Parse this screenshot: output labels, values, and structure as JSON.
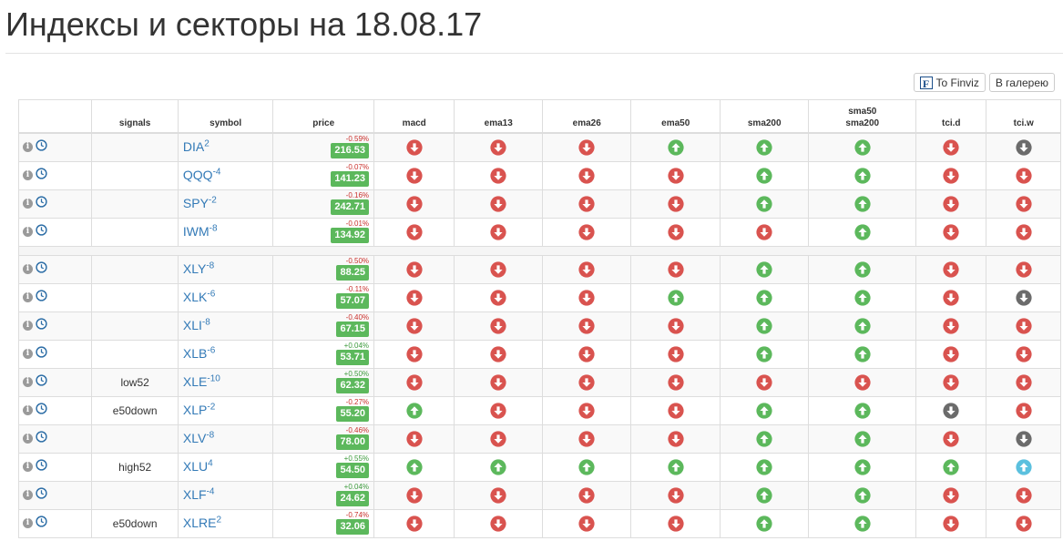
{
  "page": {
    "title": "Индексы и секторы на 18.08.17",
    "finviz_label": "To Finviz",
    "gallery_label": "В галерею",
    "finviz_logo": "F"
  },
  "table": {
    "headers": [
      "",
      "signals",
      "symbol",
      "price",
      "macd",
      "ema13",
      "ema26",
      "ema50",
      "sma200",
      "sma50\nsma200",
      "tci.d",
      "tci.w"
    ],
    "info_glyph": "i",
    "groups": [
      [
        {
          "signal": "",
          "symbol": "DIA",
          "sup": "2",
          "change": "-0.59%",
          "price": "216.53",
          "ind": [
            "down",
            "down",
            "down",
            "up",
            "up",
            "up",
            "down",
            "down-gray"
          ]
        },
        {
          "signal": "",
          "symbol": "QQQ",
          "sup": "-4",
          "change": "-0.07%",
          "price": "141.23",
          "ind": [
            "down",
            "down",
            "down",
            "down",
            "up",
            "up",
            "down",
            "down"
          ]
        },
        {
          "signal": "",
          "symbol": "SPY",
          "sup": "-2",
          "change": "-0.16%",
          "price": "242.71",
          "ind": [
            "down",
            "down",
            "down",
            "down",
            "up",
            "up",
            "down",
            "down"
          ]
        },
        {
          "signal": "",
          "symbol": "IWM",
          "sup": "-8",
          "change": "-0.01%",
          "price": "134.92",
          "ind": [
            "down",
            "down",
            "down",
            "down",
            "down",
            "up",
            "down",
            "down"
          ]
        }
      ],
      [
        {
          "signal": "",
          "symbol": "XLY",
          "sup": "-8",
          "change": "-0.50%",
          "price": "88.25",
          "ind": [
            "down",
            "down",
            "down",
            "down",
            "up",
            "up",
            "down",
            "down"
          ]
        },
        {
          "signal": "",
          "symbol": "XLK",
          "sup": "-6",
          "change": "-0.11%",
          "price": "57.07",
          "ind": [
            "down",
            "down",
            "down",
            "up",
            "up",
            "up",
            "down",
            "down-gray"
          ]
        },
        {
          "signal": "",
          "symbol": "XLI",
          "sup": "-8",
          "change": "-0.40%",
          "price": "67.15",
          "ind": [
            "down",
            "down",
            "down",
            "down",
            "up",
            "up",
            "down",
            "down"
          ]
        },
        {
          "signal": "",
          "symbol": "XLB",
          "sup": "-6",
          "change": "+0.04%",
          "price": "53.71",
          "ind": [
            "down",
            "down",
            "down",
            "down",
            "up",
            "up",
            "down",
            "down"
          ]
        },
        {
          "signal": "low52",
          "symbol": "XLE",
          "sup": "-10",
          "change": "+0.50%",
          "price": "62.32",
          "ind": [
            "down",
            "down",
            "down",
            "down",
            "down",
            "down",
            "down",
            "down"
          ]
        },
        {
          "signal": "e50down",
          "symbol": "XLP",
          "sup": "-2",
          "change": "-0.27%",
          "price": "55.20",
          "ind": [
            "up",
            "down",
            "down",
            "down",
            "up",
            "up",
            "down-gray",
            "down"
          ]
        },
        {
          "signal": "",
          "symbol": "XLV",
          "sup": "-8",
          "change": "-0.46%",
          "price": "78.00",
          "ind": [
            "down",
            "down",
            "down",
            "down",
            "up",
            "up",
            "down",
            "down-gray"
          ]
        },
        {
          "signal": "high52",
          "symbol": "XLU",
          "sup": "4",
          "change": "+0.55%",
          "price": "54.50",
          "ind": [
            "up",
            "up",
            "up",
            "up",
            "up",
            "up",
            "up",
            "up-blue"
          ]
        },
        {
          "signal": "",
          "symbol": "XLF",
          "sup": "-4",
          "change": "+0.04%",
          "price": "24.62",
          "ind": [
            "down",
            "down",
            "down",
            "down",
            "up",
            "up",
            "down",
            "down"
          ]
        },
        {
          "signal": "e50down",
          "symbol": "XLRE",
          "sup": "2",
          "change": "-0.74%",
          "price": "32.06",
          "ind": [
            "down",
            "down",
            "down",
            "down",
            "up",
            "up",
            "down",
            "down"
          ]
        }
      ]
    ]
  },
  "colors": {
    "down": "#d9534f",
    "up": "#5cb85c",
    "down-gray": "#6b6b6b",
    "up-blue": "#5bc0de",
    "price_badge": "#5cb85c"
  }
}
